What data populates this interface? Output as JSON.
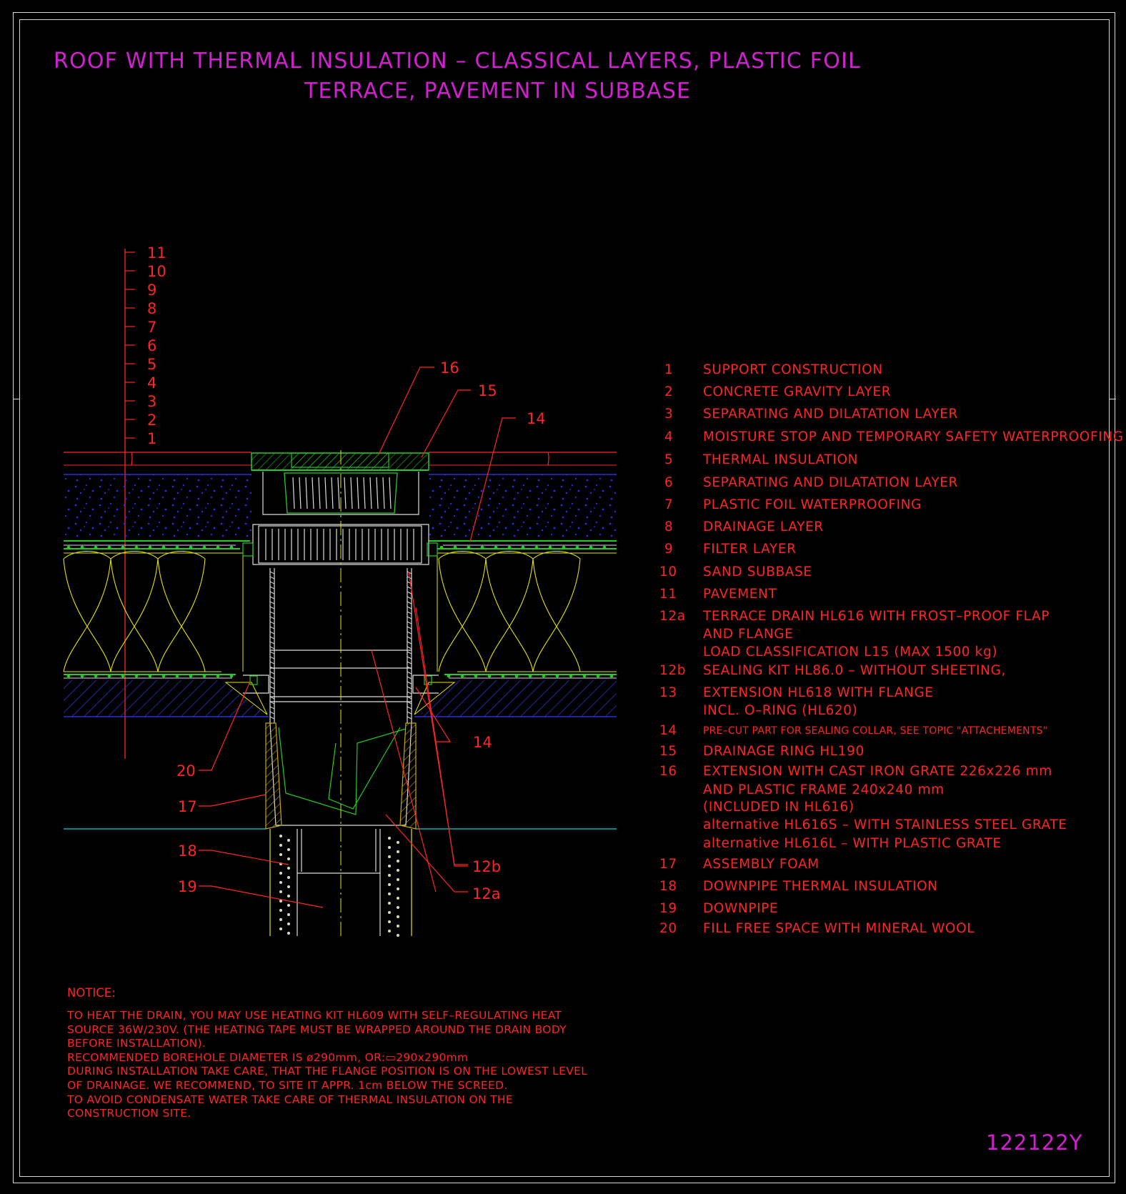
{
  "title": {
    "line1": "ROOF WITH THERMAL INSULATION – CLASSICAL LAYERS, PLASTIC FOIL",
    "line2": "TERRACE, PAVEMENT IN SUBBASE"
  },
  "layer_scale": [
    "11",
    "10",
    "9",
    "8",
    "7",
    "6",
    "5",
    "4",
    "3",
    "2",
    "1"
  ],
  "callouts": {
    "c16": "16",
    "c15": "15",
    "c14_top": "14",
    "c14_bottom": "14",
    "c20": "20",
    "c17": "17",
    "c18": "18",
    "c19": "19",
    "c12b": "12b",
    "c12a": "12a"
  },
  "legend": [
    {
      "num": "1",
      "text": "SUPPORT CONSTRUCTION"
    },
    {
      "num": "2",
      "text": "CONCRETE GRAVITY LAYER"
    },
    {
      "num": "3",
      "text": "SEPARATING AND DILATATION LAYER"
    },
    {
      "num": "4",
      "text": "MOISTURE STOP AND TEMPORARY SAFETY WATERPROOFING"
    },
    {
      "num": "5",
      "text": "THERMAL INSULATION"
    },
    {
      "num": "6",
      "text": "SEPARATING AND DILATATION LAYER"
    },
    {
      "num": "7",
      "text": "PLASTIC FOIL WATERPROOFING"
    },
    {
      "num": "8",
      "text": "DRAINAGE LAYER"
    },
    {
      "num": "9",
      "text": "FILTER LAYER"
    },
    {
      "num": "10",
      "text": "SAND SUBBASE"
    },
    {
      "num": "11",
      "text": "PAVEMENT"
    },
    {
      "num": "12a",
      "text": "TERRACE DRAIN HL616 WITH FROST–PROOF FLAP"
    },
    {
      "num": "",
      "text": "AND FLANGE"
    },
    {
      "num": "",
      "text": "LOAD CLASSIFICATION L15 (MAX 1500 kg)"
    },
    {
      "num": "12b",
      "text": "SEALING KIT HL86.0 – WITHOUT SHEETING,"
    },
    {
      "num": "13",
      "text": "EXTENSION HL618 WITH FLANGE"
    },
    {
      "num": "",
      "text": "INCL. O–RING (HL620)"
    },
    {
      "num": "14",
      "text": "PRE–CUT PART FOR SEALING COLLAR, SEE TOPIC \"ATTACHEMENTS\""
    },
    {
      "num": "15",
      "text": "DRAINAGE RING HL190"
    },
    {
      "num": "16",
      "text": "EXTENSION WITH CAST IRON GRATE 226x226 mm"
    },
    {
      "num": "",
      "text": "AND PLASTIC FRAME 240x240 mm"
    },
    {
      "num": "",
      "text": "(INCLUDED IN HL616)"
    },
    {
      "num": "",
      "text": "alternative HL616S – WITH STAINLESS STEEL GRATE"
    },
    {
      "num": "",
      "text": "alternative HL616L – WITH PLASTIC GRATE"
    },
    {
      "num": "17",
      "text": "ASSEMBLY FOAM"
    },
    {
      "num": "18",
      "text": "DOWNPIPE THERMAL INSULATION"
    },
    {
      "num": "19",
      "text": "DOWNPIPE"
    },
    {
      "num": "20",
      "text": "FILL FREE SPACE WITH MINERAL WOOL"
    }
  ],
  "notice": {
    "title": "NOTICE:",
    "lines": [
      "TO HEAT THE DRAIN, YOU MAY USE HEATING KIT HL609 WITH SELF–REGULATING HEAT",
      "SOURCE 36W/230V. (THE HEATING TAPE MUST BE WRAPPED AROUND THE DRAIN BODY",
      "BEFORE INSTALLATION).",
      "RECOMMENDED BOREHOLE DIAMETER IS ø290mm, OR:▭290x290mm",
      "DURING INSTALLATION TAKE CARE, THAT THE FLANGE POSITION IS ON THE LOWEST LEVEL",
      "OF DRAINAGE. WE RECOMMEND, TO SITE IT APPR. 1cm BELOW THE SCREED.",
      "TO AVOID CONDENSATE WATER TAKE CARE OF THERMAL INSULATION ON THE",
      "CONSTRUCTION SITE."
    ]
  },
  "drawing_code": "122122Y",
  "colors": {
    "background": "#000000",
    "title": "#d11fd1",
    "text": "#ff2424",
    "frame": "#d8d8d8",
    "gravel_dots": "#2a2aff",
    "layer_line": "#3636ff",
    "insulation": "#e6e600",
    "membrane": "#22cc22",
    "hatch": "#3a3aff",
    "drain_body": "#dcdcdc",
    "screed_line": "#00b3b3",
    "foam": "#c8a800"
  }
}
